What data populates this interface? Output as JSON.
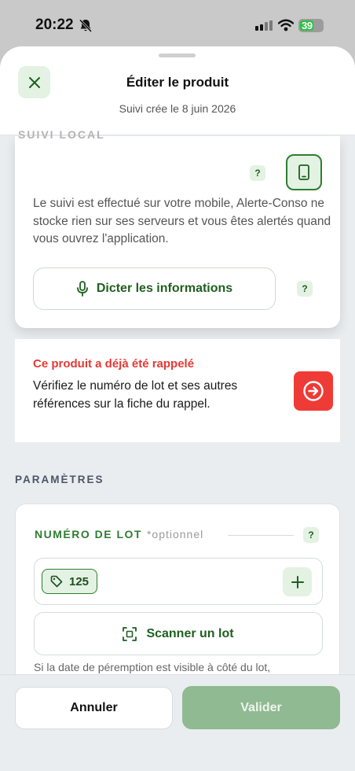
{
  "status_bar": {
    "time": "20:22",
    "battery": "39"
  },
  "header": {
    "title": "Éditer le produit",
    "subtitle": "Suivi crée le 8 juin 2026"
  },
  "local_tracking": {
    "label": "SUIVI LOCAL",
    "help": "?",
    "description": "Le suivi est effectué sur votre mobile, Alerte-Conso ne stocke rien sur ses serveurs et vous êtes alertés quand vous ouvrez l'application.",
    "dictate_label": "Dicter les informations",
    "dictate_help": "?"
  },
  "recall": {
    "title": "Ce produit a déjà été rappelé",
    "text": "Vérifiez le numéro de lot et ses autres références sur la fiche du rappel."
  },
  "params": {
    "label": "PARAMÈTRES",
    "lot_label": "NUMÉRO DE LOT",
    "lot_optional": "*optionnel",
    "lot_help": "?",
    "lot_value": "125",
    "scan_label": "Scanner un lot",
    "hint": "Si la date de péremption est visible à côté du lot,"
  },
  "footer": {
    "cancel_label": "Annuler",
    "validate_label": "Valider"
  },
  "colors": {
    "accent_green": "#2e7d32",
    "light_green": "#e3f2e3",
    "alert_red": "#ef3b36",
    "validate_disabled": "#8fba92"
  },
  "icons": [
    "bell-slash-icon",
    "signal-icon",
    "wifi-icon",
    "battery-icon",
    "close-icon",
    "phone-icon",
    "microphone-icon",
    "arrow-right-circle-icon",
    "tag-icon",
    "plus-icon",
    "scan-icon"
  ]
}
